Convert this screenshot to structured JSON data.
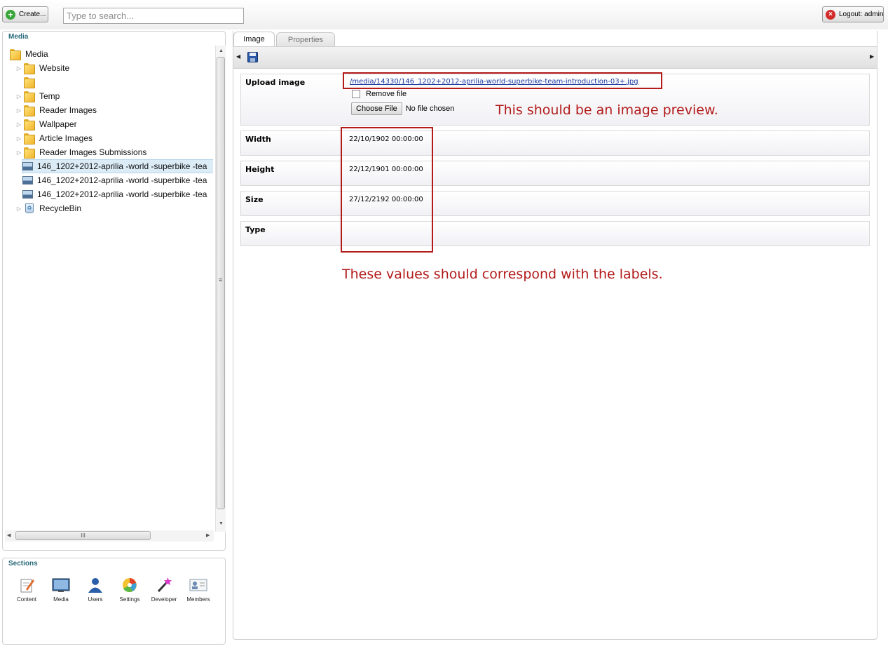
{
  "topbar": {
    "create_label": "Create...",
    "search_placeholder": "Type to search...",
    "logout_label": "Logout: admin"
  },
  "media_panel": {
    "title": "Media",
    "tree": [
      {
        "label": "Media",
        "type": "folder",
        "level": 0
      },
      {
        "label": "Website",
        "type": "folder",
        "level": 1,
        "expandable": true
      },
      {
        "label": "",
        "type": "folder",
        "level": 1,
        "expandable": false
      },
      {
        "label": "Temp",
        "type": "folder",
        "level": 1,
        "expandable": true
      },
      {
        "label": "Reader Images",
        "type": "folder",
        "level": 1,
        "expandable": true
      },
      {
        "label": "Wallpaper",
        "type": "folder",
        "level": 1,
        "expandable": true
      },
      {
        "label": "Article Images",
        "type": "folder",
        "level": 1,
        "expandable": true
      },
      {
        "label": "Reader Images Submissions",
        "type": "folder",
        "level": 1,
        "expandable": true
      },
      {
        "label": "146_1202+2012-aprilia -world -superbike -tea",
        "type": "image",
        "level": 1,
        "selected": true
      },
      {
        "label": "146_1202+2012-aprilia -world -superbike -tea",
        "type": "image",
        "level": 1
      },
      {
        "label": "146_1202+2012-aprilia -world -superbike -tea",
        "type": "image",
        "level": 1
      },
      {
        "label": "RecycleBin",
        "type": "recyclebin",
        "level": 1,
        "expandable": true
      }
    ],
    "scrollbar_grip": "III"
  },
  "sections_panel": {
    "title": "Sections",
    "items": [
      {
        "label": "Content",
        "icon": "content-icon"
      },
      {
        "label": "Media",
        "icon": "media-icon"
      },
      {
        "label": "Users",
        "icon": "users-icon"
      },
      {
        "label": "Settings",
        "icon": "settings-icon"
      },
      {
        "label": "Developer",
        "icon": "developer-icon"
      },
      {
        "label": "Members",
        "icon": "members-icon"
      }
    ]
  },
  "editor": {
    "tabs": [
      {
        "label": "Image",
        "active": true
      },
      {
        "label": "Properties",
        "active": false
      }
    ],
    "upload": {
      "label": "Upload image",
      "file_link": "/media/14330/146_1202+2012-aprilia-world-superbike-team-introduction-03+.jpg",
      "remove_label": "Remove file",
      "choose_label": "Choose File",
      "no_file_label": "No file chosen"
    },
    "properties": [
      {
        "label": "Width",
        "value": "22/10/1902 00:00:00"
      },
      {
        "label": "Height",
        "value": "22/12/1901 00:00:00"
      },
      {
        "label": "Size",
        "value": "27/12/2192 00:00:00"
      },
      {
        "label": "Type",
        "value": ""
      }
    ]
  },
  "annotations": {
    "preview_note": "This should be an image preview.",
    "values_note": "These values should correspond with the labels.",
    "color": "#b31b1b"
  }
}
